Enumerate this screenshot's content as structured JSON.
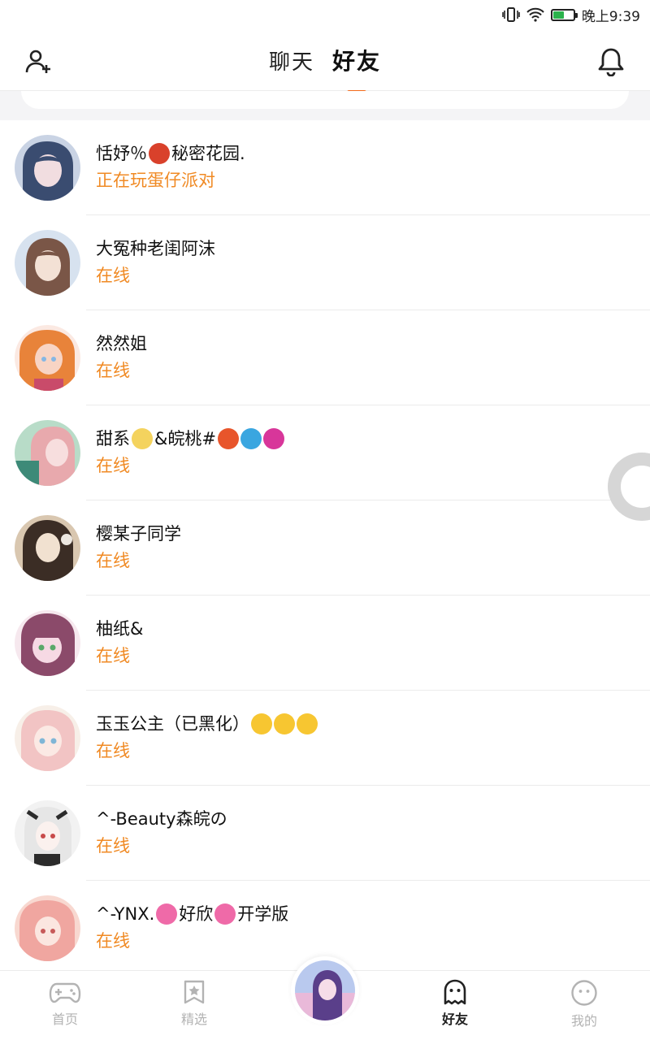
{
  "status_bar": {
    "time": "晚上9:39",
    "battery_level": 0.55,
    "battery_color": "#2bb24c",
    "icons": [
      "vibrate-icon",
      "wifi-icon",
      "battery-icon"
    ]
  },
  "header": {
    "tabs": [
      {
        "label": "聊天",
        "active": false
      },
      {
        "label": "好友",
        "active": true
      }
    ],
    "accent": "#f26a1b",
    "left_icon": "add-friend-icon",
    "right_icon": "bell-icon"
  },
  "friends": [
    {
      "name": "恬妤％",
      "emoji1": "rose",
      "name_b": "秘密花园.",
      "status": "正在玩蛋仔派对",
      "palette": [
        "#3a4c70",
        "#c9d3e4",
        "#f1dde0"
      ]
    },
    {
      "name": "大冤种老闺阿沫",
      "status": "在线",
      "palette": [
        "#7a5647",
        "#d7e2ef",
        "#f3e1d5"
      ]
    },
    {
      "name": "然然姐",
      "status": "在线",
      "palette": [
        "#e8833a",
        "#f8d4c4",
        "#86b7e4"
      ]
    },
    {
      "name": "甜系",
      "name_b": "&皖桃#",
      "status": "在线",
      "palette": [
        "#e8a9ad",
        "#b8dcc8",
        "#3d8a78"
      ]
    },
    {
      "name": "樱某子同学",
      "status": "在线",
      "palette": [
        "#3b2d25",
        "#d9c7b0",
        "#8a6a4f"
      ]
    },
    {
      "name": "柚纸&",
      "status": "在线",
      "palette": [
        "#8b4a6a",
        "#f6d9e4",
        "#9bc8e8"
      ]
    },
    {
      "name": "玉玉公主（已黑化）",
      "status": "在线",
      "palette": [
        "#f2c4c4",
        "#d7e8f2",
        "#f7efe8"
      ]
    },
    {
      "name": "^-Beauty森皖の",
      "status": "在线",
      "palette": [
        "#2b2b2b",
        "#f2f2f2",
        "#c84b4b"
      ]
    },
    {
      "name": "^-YNX.",
      "name_b": "好欣",
      "name_c": "开学版",
      "status": "在线",
      "palette": [
        "#f0a6a0",
        "#f8d8d0",
        "#c75a5a"
      ]
    }
  ],
  "status_color": "#f08a24",
  "bottom_nav": [
    {
      "label": "首页",
      "icon": "gamepad-icon",
      "active": false
    },
    {
      "label": "精选",
      "icon": "star-bookmark-icon",
      "active": false
    },
    {
      "label": "好友",
      "icon": "ghost-icon",
      "active": true
    },
    {
      "label": "我的",
      "icon": "face-icon",
      "active": false
    }
  ]
}
